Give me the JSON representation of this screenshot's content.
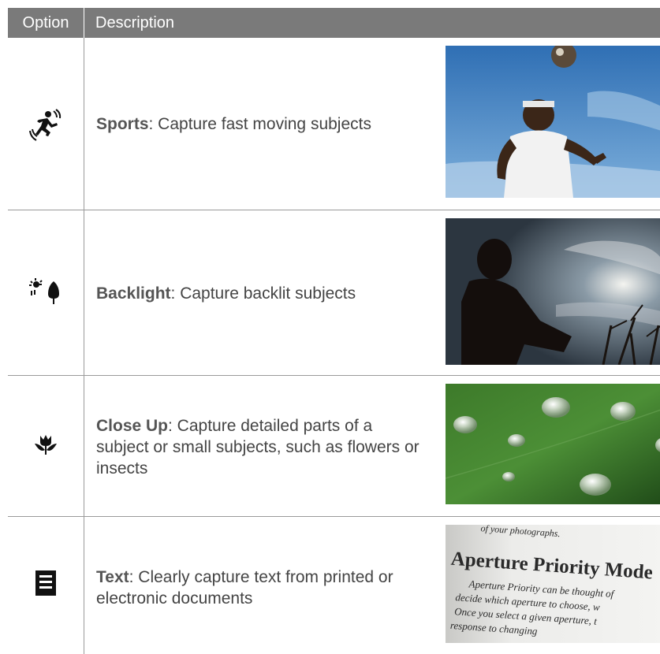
{
  "header": {
    "option": "Option",
    "description": "Description"
  },
  "rows": [
    {
      "title": "Sports",
      "text": ": Capture fast moving subjects"
    },
    {
      "title": "Backlight",
      "text": ": Capture backlit subjects"
    },
    {
      "title": "Close Up",
      "text": ": Capture detailed parts of a subject or small subjects, such as flowers or insects"
    },
    {
      "title": "Text",
      "text": ": Clearly capture text from printed or electronic documents"
    }
  ],
  "text_photo": {
    "line1": "of your photographs.",
    "heading": "Aperture Priority Mode",
    "p1": "Aperture Priority can be thought of",
    "p2": "decide which aperture to choose, w",
    "p3": "Once you select a given aperture, t",
    "p4": "response to changing"
  },
  "colors": {
    "header_bg": "#7a7a7a",
    "rule": "#9a9a9a",
    "text": "#444444"
  }
}
